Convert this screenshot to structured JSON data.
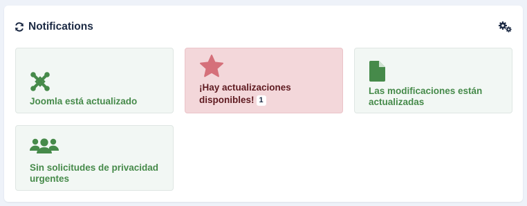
{
  "header": {
    "title": "Notifications",
    "icon": "refresh-icon",
    "options_icon": "gears-icon"
  },
  "tiles": [
    {
      "label": "Joomla está actualizado",
      "icon": "joomla-icon",
      "state": "success"
    },
    {
      "label": "¡Hay actualizaciones disponibles!",
      "badge": "1",
      "icon": "star-icon",
      "state": "danger"
    },
    {
      "label": "Las modificaciones están actualizadas",
      "icon": "file-icon",
      "state": "success"
    },
    {
      "label": "Sin solicitudes de privacidad urgentes",
      "icon": "users-icon",
      "state": "success"
    }
  ],
  "colors": {
    "success_text": "#468a4a",
    "success_bg": "#f2f7f4",
    "danger_text": "#5e1a20",
    "danger_bg": "#f3d7da",
    "danger_icon": "#d5707a",
    "title": "#1c2a44"
  }
}
